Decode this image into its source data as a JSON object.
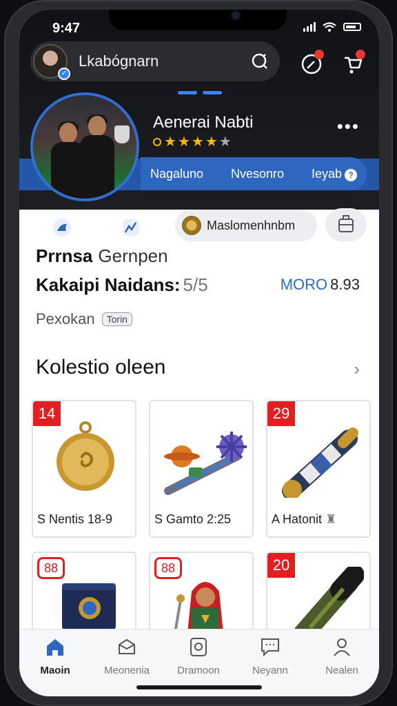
{
  "status_bar": {
    "time": "9:47"
  },
  "header": {
    "search_text": "Lkabógnarn",
    "icons": [
      "search-icon",
      "compass-icon",
      "cart-icon"
    ],
    "notification_color": "#e53935"
  },
  "profile": {
    "name": "Aenerai Nabti",
    "rating": 4,
    "rating_max": 5,
    "tabs": [
      "Nagaluno",
      "Nvesonro",
      "Ieyab"
    ],
    "accent_color": "#2f66c0"
  },
  "actions": {
    "chip_label": "Maslomenhnbm"
  },
  "info": {
    "line1_bold": "Prrnsa",
    "line1_rest": "Gernpen",
    "line2_bold": "Kakaipi Naidans:",
    "line2_value": "5/5",
    "moro_label": "MORO",
    "moro_value": "8.93",
    "line3_text": "Pexokan",
    "tag": "Torin"
  },
  "collection": {
    "title": "Kolestio oleen",
    "cards": [
      {
        "badge": "14",
        "label": "S Nentis 18-9",
        "icon": "gold-medal-icon"
      },
      {
        "badge": "",
        "label": "S Gamto 2:25",
        "icon": "toy-figures-icon"
      },
      {
        "badge": "29",
        "label": "A Hatonit",
        "icon": "baton-icon"
      },
      {
        "badge": "88",
        "label": "",
        "icon": "box-icon"
      },
      {
        "badge": "88",
        "label": "",
        "icon": "figure-icon"
      },
      {
        "badge": "20",
        "label": "",
        "icon": "tube-icon"
      }
    ]
  },
  "bottom_nav": [
    {
      "label": "Maoin",
      "icon": "home-icon",
      "active": true
    },
    {
      "label": "Meonenia",
      "icon": "box-icon",
      "active": false
    },
    {
      "label": "Dramoon",
      "icon": "badge-icon",
      "active": false
    },
    {
      "label": "Neyann",
      "icon": "chat-icon",
      "active": false
    },
    {
      "label": "Nealen",
      "icon": "user-icon",
      "active": false
    }
  ]
}
